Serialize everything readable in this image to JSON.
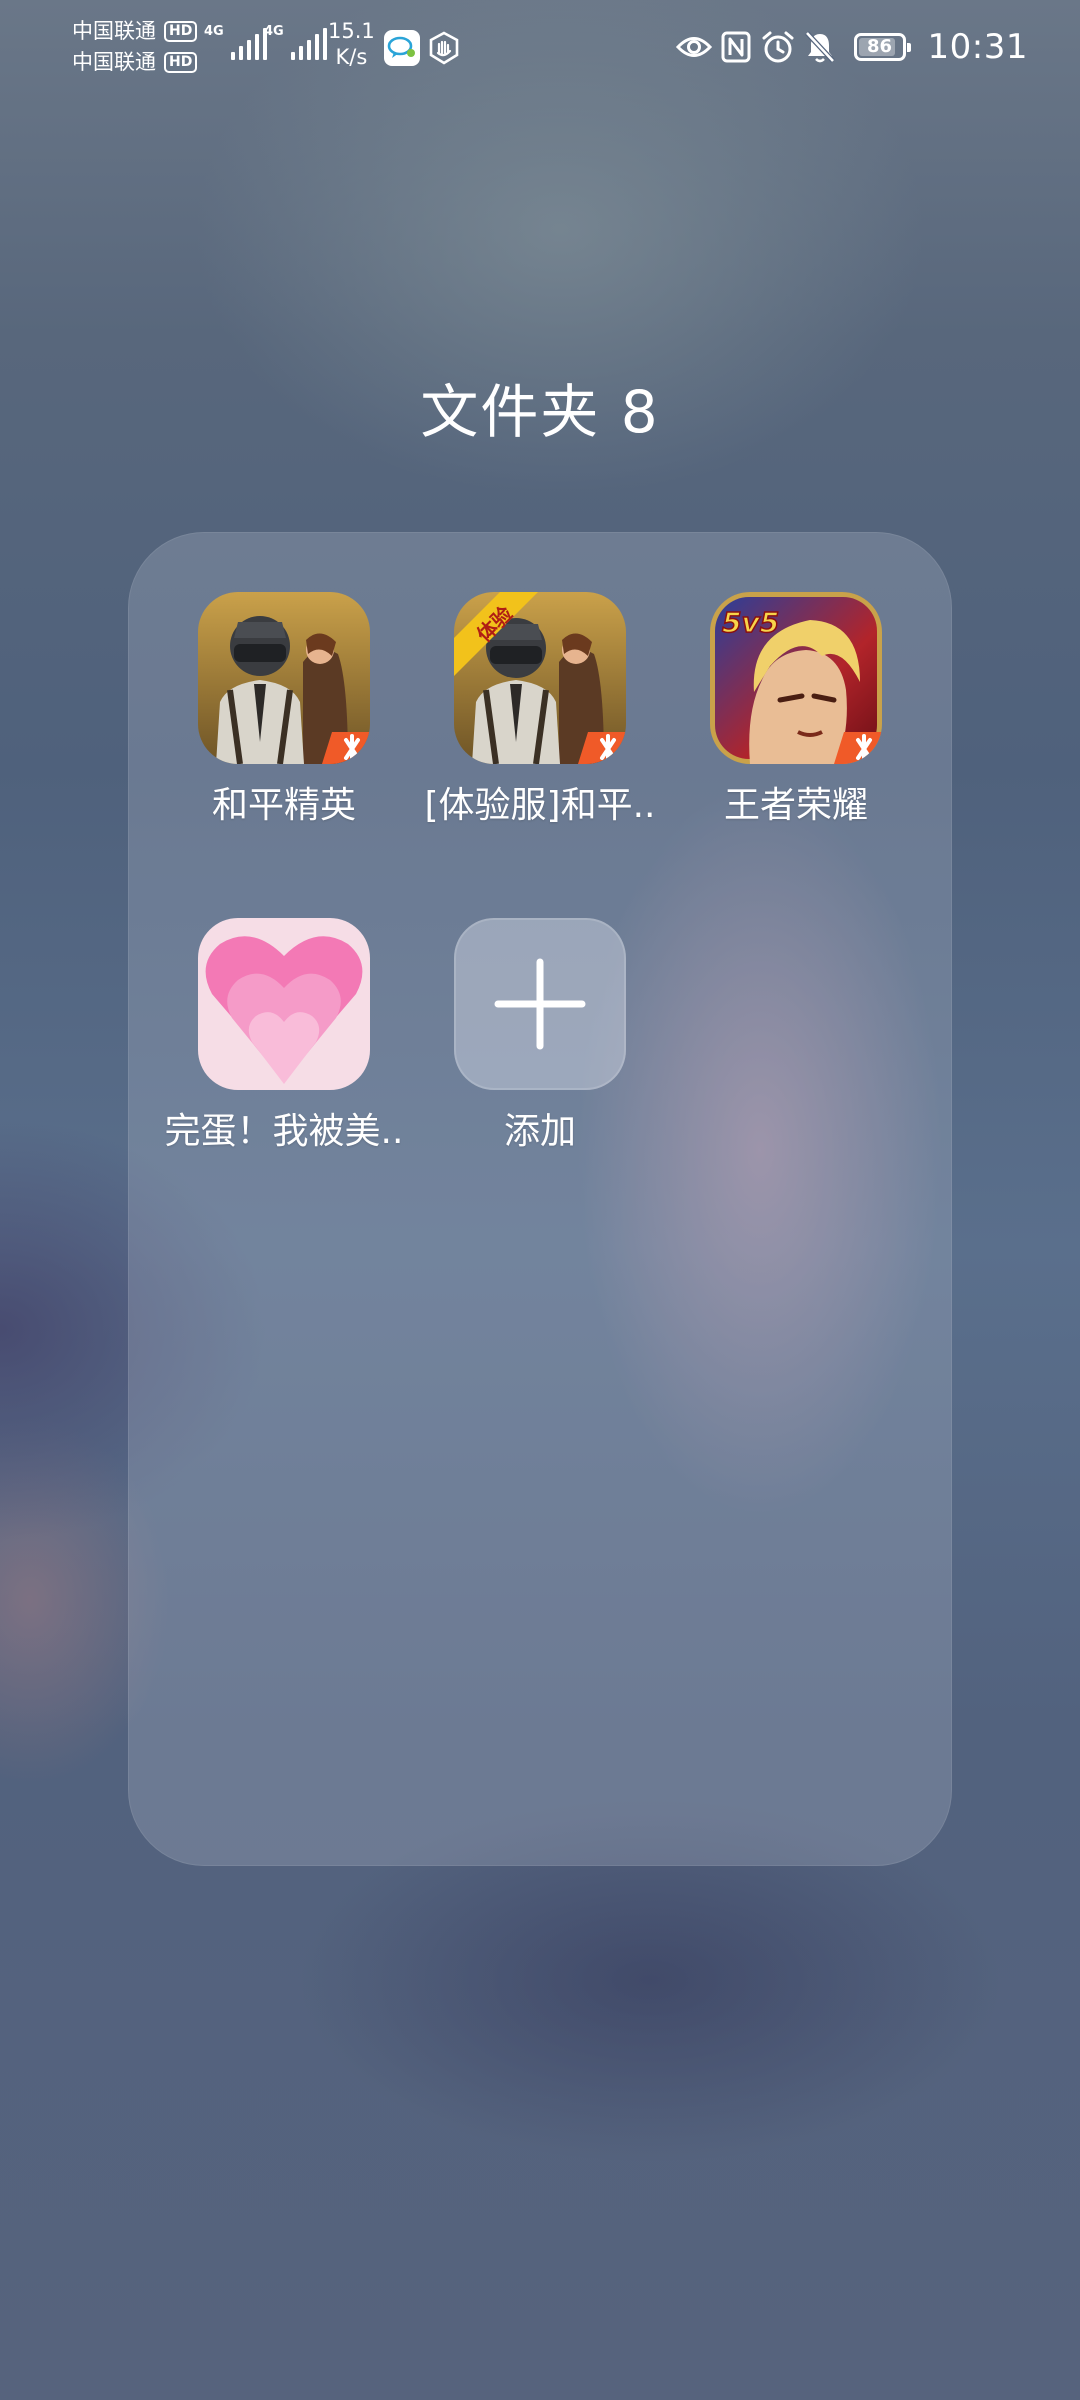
{
  "status_bar": {
    "carrier_1": "中国联通",
    "carrier_2": "中国联通",
    "hd_label": "HD",
    "network_type": "4G",
    "net_speed_value": "15.1",
    "net_speed_unit": "K/s",
    "battery_level": "86",
    "time": "10:31",
    "icons": [
      "chat-bubble-icon",
      "hand-shield-icon",
      "eye-icon",
      "nfc-icon",
      "alarm-icon",
      "bell-off-icon",
      "battery-icon"
    ]
  },
  "folder": {
    "title": "文件夹 8",
    "apps": [
      {
        "label": "和平精英",
        "icon": "pubg-game-icon"
      },
      {
        "label": "[体验服]和平..",
        "icon": "pubg-beta-game-icon",
        "badge": "体验"
      },
      {
        "label": "王者荣耀",
        "icon": "honor-of-kings-icon",
        "badge": "5v5"
      },
      {
        "label": "完蛋！我被美..",
        "icon": "heart-app-icon"
      },
      {
        "label": "添加",
        "icon": "plus-icon"
      }
    ]
  },
  "colors": {
    "panel": "#b9c3d2",
    "accent_orange": "#f05a28",
    "heart_pink": "#f07bb5"
  }
}
